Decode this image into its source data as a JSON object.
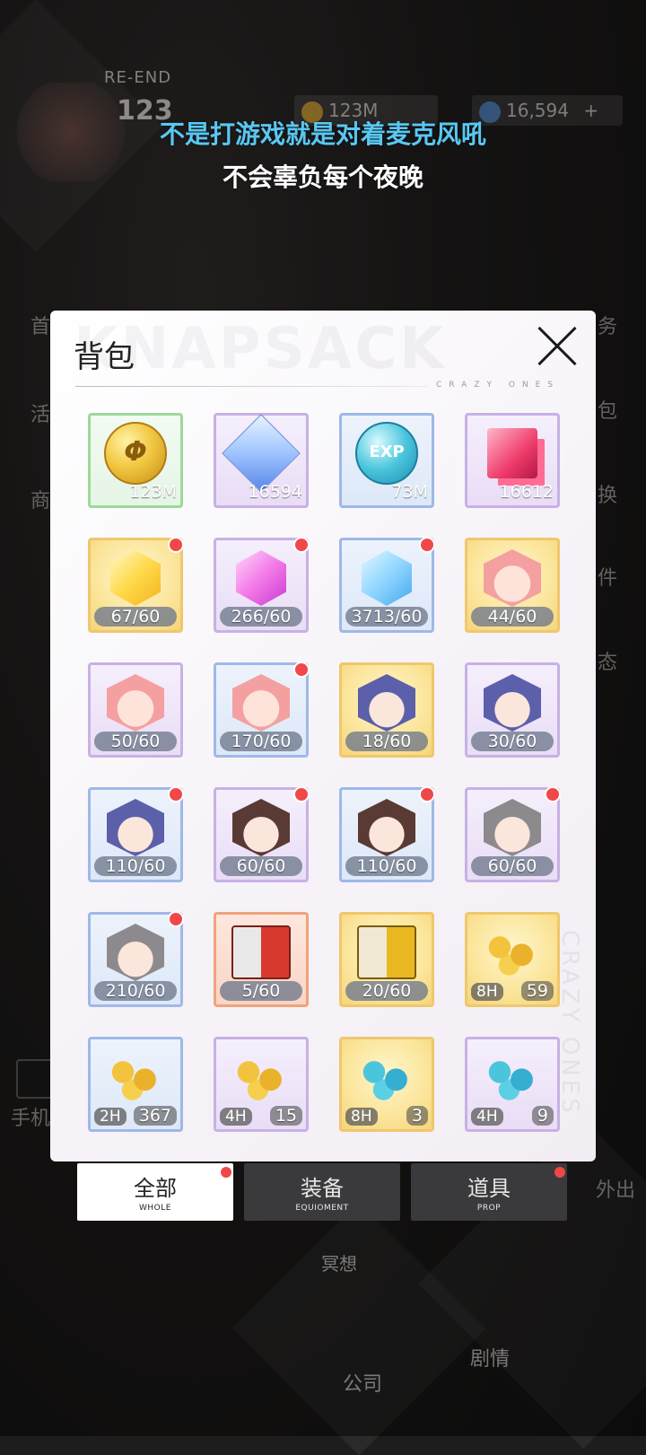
{
  "hud": {
    "title": "RE-END",
    "level": "123",
    "coins": "123M",
    "gems": "16,594",
    "gems_plus": "+"
  },
  "lyrics": {
    "line1": "不是打游戏就是对着麦克风吼",
    "line2": "不会辜负每个夜晚"
  },
  "background_labels": {
    "left1": "首",
    "left2": "活",
    "left3": "商",
    "right1": "务",
    "right2": "包",
    "right3": "换",
    "right4": "件",
    "right5": "态",
    "phone": "手机",
    "outing": "外出",
    "company": "公司",
    "bottom_mid": "冥想",
    "bottom_right": "剧情"
  },
  "dialog": {
    "title": "背包",
    "watermark": "KNAPSACK",
    "tagline": "CRAZY ONES",
    "vertical_tag": "CRAZY ONES",
    "items": [
      {
        "icon": "gold-coin",
        "frame": "green",
        "count": "123M",
        "dot": false
      },
      {
        "icon": "diamond",
        "frame": "purple",
        "count": "16594",
        "dot": false
      },
      {
        "icon": "exp-coin",
        "frame": "blue",
        "count": "73M",
        "dot": false
      },
      {
        "icon": "red-cube",
        "frame": "purple",
        "count": "16612",
        "dot": false
      },
      {
        "icon": "yellow-crystal",
        "frame": "gold",
        "count": "67/60",
        "dot": true
      },
      {
        "icon": "pink-crystal",
        "frame": "purple",
        "count": "266/60",
        "dot": true
      },
      {
        "icon": "blue-crystal",
        "frame": "blue",
        "count": "3713/60",
        "dot": true
      },
      {
        "icon": "pink-hair-shard",
        "frame": "gold",
        "count": "44/60",
        "dot": false
      },
      {
        "icon": "pink-hair-shard",
        "frame": "purple",
        "count": "50/60",
        "dot": false
      },
      {
        "icon": "pink-hair-shard",
        "frame": "blue",
        "count": "170/60",
        "dot": true
      },
      {
        "icon": "glasses-shard",
        "frame": "gold",
        "count": "18/60",
        "dot": false
      },
      {
        "icon": "glasses-shard",
        "frame": "purple",
        "count": "30/60",
        "dot": false
      },
      {
        "icon": "glasses-shard",
        "frame": "blue",
        "count": "110/60",
        "dot": true
      },
      {
        "icon": "brown-hair-shard",
        "frame": "purple",
        "count": "60/60",
        "dot": true
      },
      {
        "icon": "brown-hair-shard",
        "frame": "blue",
        "count": "110/60",
        "dot": true
      },
      {
        "icon": "grey-hair-shard",
        "frame": "purple",
        "count": "60/60",
        "dot": true
      },
      {
        "icon": "grey-hair-shard",
        "frame": "blue",
        "count": "210/60",
        "dot": true
      },
      {
        "icon": "red-mystery-box",
        "frame": "orange",
        "count": "5/60",
        "dot": false
      },
      {
        "icon": "yellow-mystery-box",
        "frame": "gold",
        "count": "20/60",
        "dot": false
      },
      {
        "icon": "gold-coin-pile",
        "frame": "gold",
        "hours": "8H",
        "count": "59",
        "dot": false
      },
      {
        "icon": "gold-coin-pile",
        "frame": "blue",
        "hours": "2H",
        "count": "367",
        "dot": false
      },
      {
        "icon": "gold-coin-pile",
        "frame": "purple",
        "hours": "4H",
        "count": "15",
        "dot": false
      },
      {
        "icon": "exp-coin-pile",
        "frame": "gold",
        "hours": "8H",
        "count": "3",
        "dot": false
      },
      {
        "icon": "exp-coin-pile",
        "frame": "purple",
        "hours": "4H",
        "count": "9",
        "dot": false
      }
    ]
  },
  "tabs": [
    {
      "label": "全部",
      "sub": "WHOLE",
      "active": true,
      "dot": true
    },
    {
      "label": "装备",
      "sub": "EQUIOMENT",
      "active": false,
      "dot": false
    },
    {
      "label": "道具",
      "sub": "PROP",
      "active": false,
      "dot": true
    }
  ],
  "colors": {
    "notification": "#f04848",
    "lyric_accent": "#59c8f3"
  }
}
